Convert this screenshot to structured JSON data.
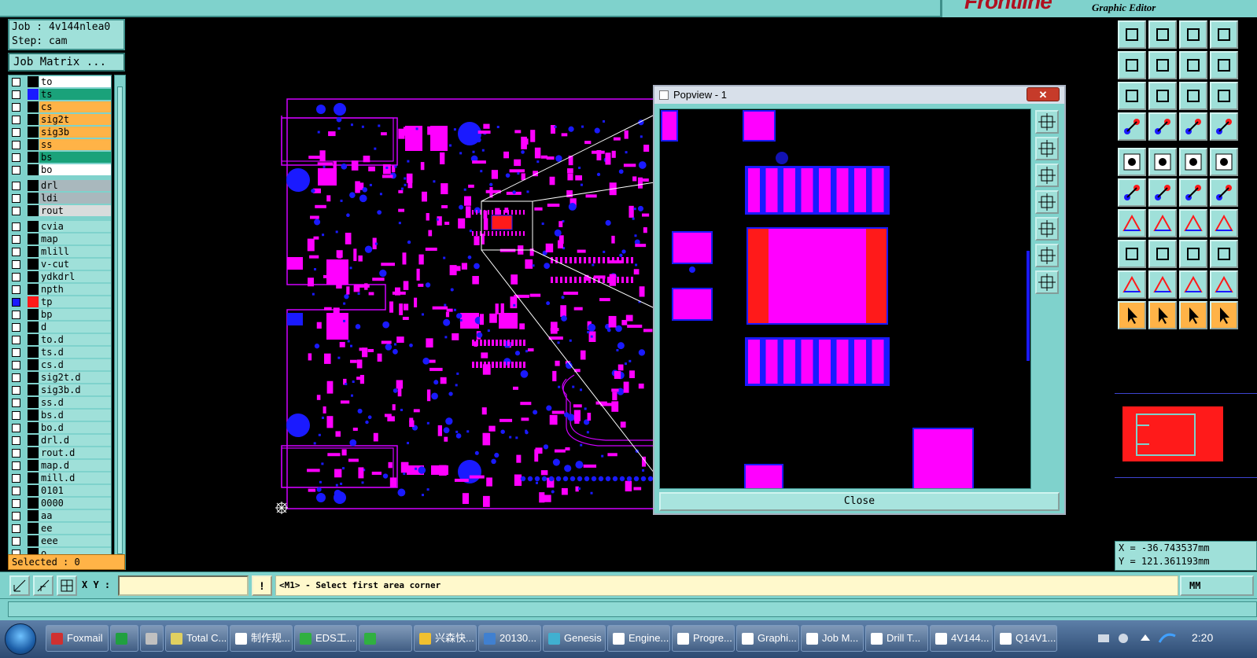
{
  "brand": {
    "logo": "Frontline",
    "subtitle": "Graphic Editor"
  },
  "job": {
    "job_line": "Job : 4v144nlea0",
    "step_line": "Step: cam",
    "matrix_label": "Job Matrix ..."
  },
  "layers": [
    {
      "name": "to",
      "bg": "#ffffff",
      "sw": "#000000"
    },
    {
      "name": "ts",
      "bg": "#1aa27a",
      "sw": "#1a1aff"
    },
    {
      "name": "cs",
      "bg": "#ffb347",
      "sw": "#000000"
    },
    {
      "name": "sig2t",
      "bg": "#ffb347",
      "sw": "#000000"
    },
    {
      "name": "sig3b",
      "bg": "#ffb347",
      "sw": "#000000"
    },
    {
      "name": "ss",
      "bg": "#ffb347",
      "sw": "#000000"
    },
    {
      "name": "bs",
      "bg": "#1aa27a",
      "sw": "#000000"
    },
    {
      "name": "bo",
      "bg": "#ffffff",
      "sw": "#000000",
      "sep": true
    },
    {
      "name": "drl",
      "bg": "#a9b8bd",
      "sw": "#000000"
    },
    {
      "name": "ldi",
      "bg": "#a9b8bd",
      "sw": "#000000"
    },
    {
      "name": "rout",
      "bg": "#d8dcdc",
      "sw": "#000000",
      "sep": true
    },
    {
      "name": "cvia",
      "bg": "#9fe0d9",
      "sw": "#000000"
    },
    {
      "name": "map",
      "bg": "#9fe0d9",
      "sw": "#000000"
    },
    {
      "name": "mlill",
      "bg": "#9fe0d9",
      "sw": "#000000"
    },
    {
      "name": "v-cut",
      "bg": "#9fe0d9",
      "sw": "#000000"
    },
    {
      "name": "ydkdrl",
      "bg": "#9fe0d9",
      "sw": "#000000"
    },
    {
      "name": "npth",
      "bg": "#9fe0d9",
      "sw": "#000000"
    },
    {
      "name": "tp",
      "bg": "#9fe0d9",
      "sw": "#ff1a1a",
      "checked": true
    },
    {
      "name": "bp",
      "bg": "#9fe0d9",
      "sw": "#000000"
    },
    {
      "name": "d",
      "bg": "#9fe0d9",
      "sw": "#000000"
    },
    {
      "name": "to.d",
      "bg": "#9fe0d9",
      "sw": "#000000"
    },
    {
      "name": "ts.d",
      "bg": "#9fe0d9",
      "sw": "#000000"
    },
    {
      "name": "cs.d",
      "bg": "#9fe0d9",
      "sw": "#000000"
    },
    {
      "name": "sig2t.d",
      "bg": "#9fe0d9",
      "sw": "#000000"
    },
    {
      "name": "sig3b.d",
      "bg": "#9fe0d9",
      "sw": "#000000"
    },
    {
      "name": "ss.d",
      "bg": "#9fe0d9",
      "sw": "#000000"
    },
    {
      "name": "bs.d",
      "bg": "#9fe0d9",
      "sw": "#000000"
    },
    {
      "name": "bo.d",
      "bg": "#9fe0d9",
      "sw": "#000000"
    },
    {
      "name": "drl.d",
      "bg": "#9fe0d9",
      "sw": "#000000"
    },
    {
      "name": "rout.d",
      "bg": "#9fe0d9",
      "sw": "#000000"
    },
    {
      "name": "map.d",
      "bg": "#9fe0d9",
      "sw": "#000000"
    },
    {
      "name": "mill.d",
      "bg": "#9fe0d9",
      "sw": "#000000"
    },
    {
      "name": "0101",
      "bg": "#9fe0d9",
      "sw": "#000000"
    },
    {
      "name": "0000",
      "bg": "#9fe0d9",
      "sw": "#000000"
    },
    {
      "name": "aa",
      "bg": "#9fe0d9",
      "sw": "#000000"
    },
    {
      "name": "ee",
      "bg": "#9fe0d9",
      "sw": "#000000"
    },
    {
      "name": "eee",
      "bg": "#9fe0d9",
      "sw": "#000000"
    },
    {
      "name": "o",
      "bg": "#9fe0d9",
      "sw": "#000000"
    }
  ],
  "selected_label": "Selected : 0",
  "popview": {
    "title": "Popview - 1",
    "close_label": "Close",
    "close_x": "✕"
  },
  "coords": {
    "x": "X = -36.743537mm",
    "y": "Y = 121.361193mm"
  },
  "command": {
    "xy_label": "X Y :",
    "xy_value": "",
    "message": "<M1> - Select first area corner",
    "unit": "MM",
    "warn": "!"
  },
  "colors": {
    "pad": "#ff00ff",
    "outline": "#1a1aff",
    "copper": "#ff0000",
    "panel": "#7fd2cc"
  },
  "taskbar": {
    "items": [
      {
        "label": "Foxmail",
        "icon": "#d03030"
      },
      {
        "label": "",
        "icon": "#20a040"
      },
      {
        "label": "",
        "icon": "#c0c0c0"
      },
      {
        "label": "Total C...",
        "icon": "#e0d060"
      },
      {
        "label": "制作规...",
        "icon": "#ffffff"
      },
      {
        "label": "EDS工...",
        "icon": "#30b040"
      },
      {
        "label": "",
        "icon": "#30b040"
      },
      {
        "label": "兴森快...",
        "icon": "#f0c030"
      },
      {
        "label": "20130...",
        "icon": "#4080d0"
      },
      {
        "label": "Genesis",
        "icon": "#40b0d0"
      },
      {
        "label": "Engine...",
        "icon": "#ffffff"
      },
      {
        "label": "Progre...",
        "icon": "#ffffff"
      },
      {
        "label": "Graphi...",
        "icon": "#ffffff"
      },
      {
        "label": "Job M...",
        "icon": "#ffffff"
      },
      {
        "label": "Drill T...",
        "icon": "#ffffff"
      },
      {
        "label": "4V144...",
        "icon": "#ffffff"
      },
      {
        "label": "Q14V1...",
        "icon": "#ffffff"
      }
    ],
    "clock": "2:20"
  }
}
